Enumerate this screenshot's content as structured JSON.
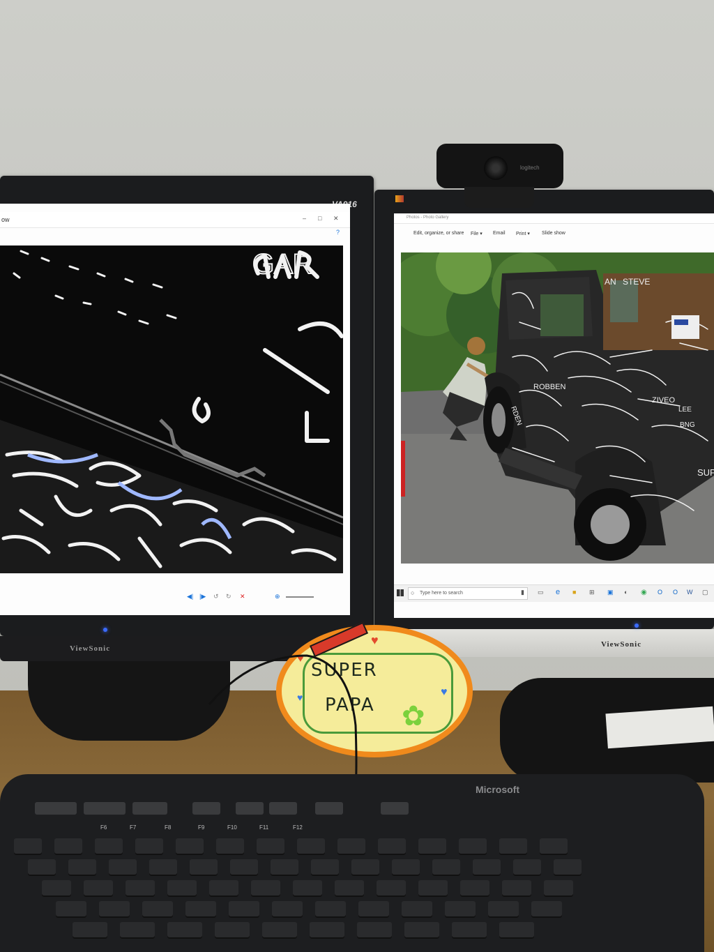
{
  "scene": "desk-photo",
  "left_monitor": {
    "brand": "ViewSonic",
    "model": "VA916",
    "window_title": "ow",
    "window_controls": [
      "–",
      "□",
      "✕"
    ],
    "photo_text": "GAR",
    "led_color": "#3b6bff"
  },
  "right_monitor": {
    "brand": "ViewSonic",
    "window_title": "Photos - Photo Gallery",
    "toolbar": {
      "edit": "Edit, organize, or share",
      "file": "File ▾",
      "email": "Email",
      "print": "Print ▾",
      "slideshow": "Slide show"
    },
    "taskbar": {
      "search_placeholder": "Type here to search"
    },
    "car_writing": [
      "AN",
      "STEVE",
      "ZIVEO",
      "LEE",
      "BNG",
      "SUP",
      "ROBBEN",
      "RDEN"
    ],
    "led_color": "#3b6bff"
  },
  "webcam": {
    "brand": "logitech"
  },
  "sign": {
    "line1": "SUPER",
    "line2": "PAPA",
    "fill": "#f5ec9a",
    "border": "#f08a1c"
  },
  "keyboard": {
    "brand": "Microsoft",
    "fkeys": [
      "F6",
      "F7",
      "F8",
      "F9",
      "F10",
      "F11",
      "F12"
    ]
  },
  "colors": {
    "accent_blue": "#1a73d9",
    "chrome_icon": "#34a853",
    "outlook_icon": "#0a64c8",
    "word_icon": "#2b579a"
  }
}
